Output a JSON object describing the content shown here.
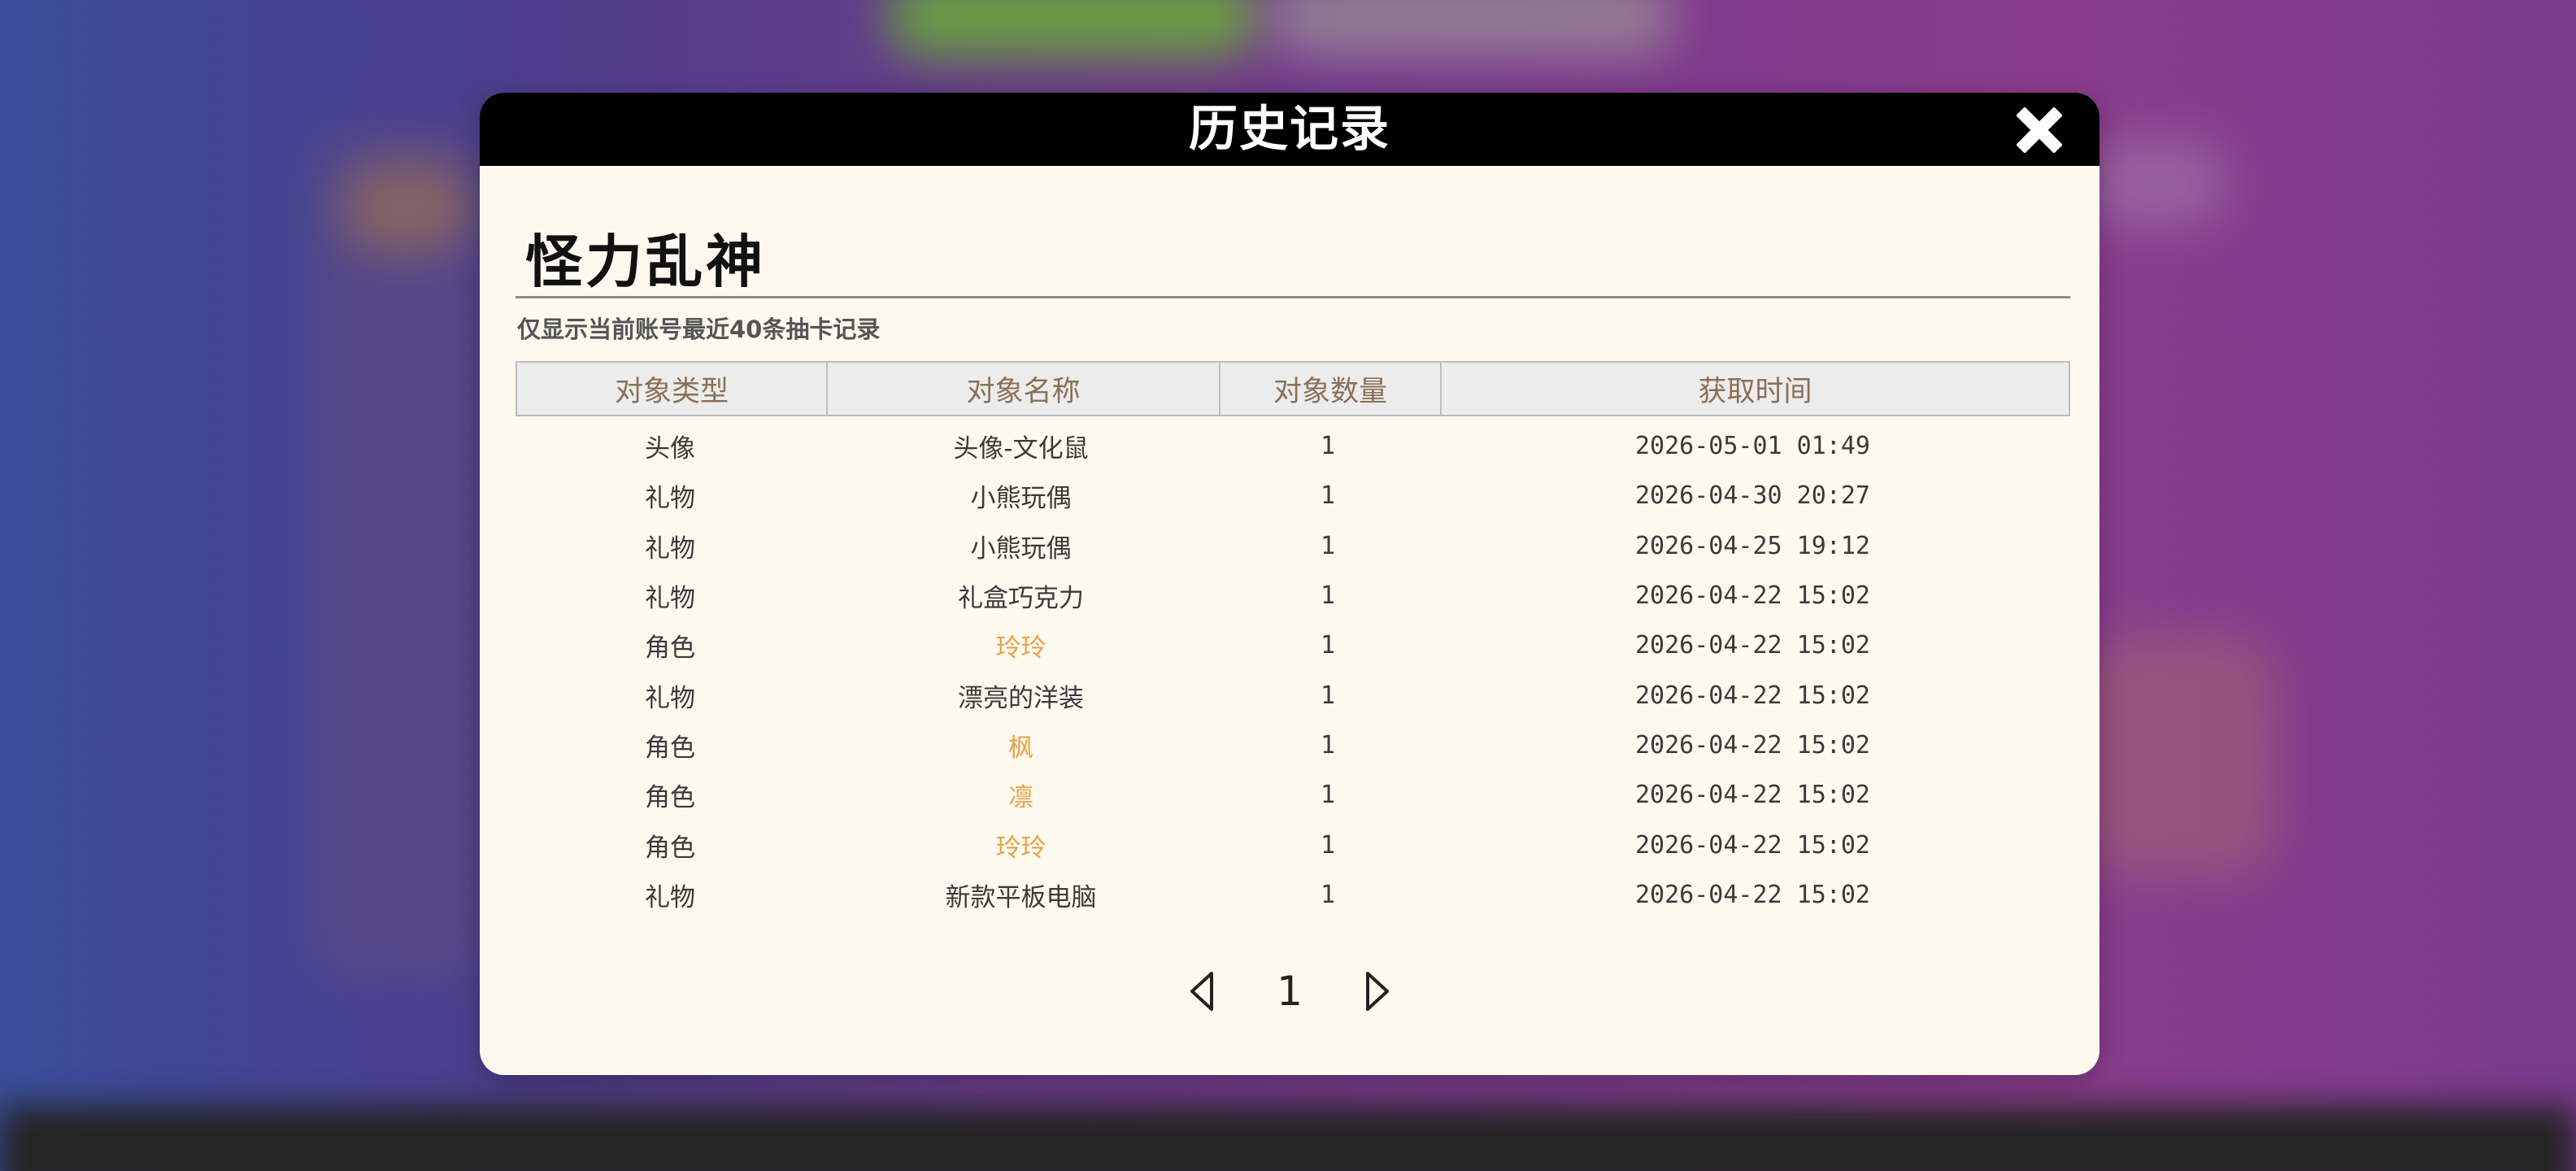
{
  "dialog": {
    "title": "历史记录",
    "section_title": "怪力乱神",
    "notice": "仅显示当前账号最近40条抽卡记录"
  },
  "table": {
    "headers": [
      "对象类型",
      "对象名称",
      "对象数量",
      "获取时间"
    ],
    "rows": [
      {
        "type": "头像",
        "name": "头像-文化鼠",
        "count": "1",
        "time": "2026-05-01 01:49",
        "highlight": false
      },
      {
        "type": "礼物",
        "name": "小熊玩偶",
        "count": "1",
        "time": "2026-04-30 20:27",
        "highlight": false
      },
      {
        "type": "礼物",
        "name": "小熊玩偶",
        "count": "1",
        "time": "2026-04-25 19:12",
        "highlight": false
      },
      {
        "type": "礼物",
        "name": "礼盒巧克力",
        "count": "1",
        "time": "2026-04-22 15:02",
        "highlight": false
      },
      {
        "type": "角色",
        "name": "玲玲",
        "count": "1",
        "time": "2026-04-22 15:02",
        "highlight": true
      },
      {
        "type": "礼物",
        "name": "漂亮的洋装",
        "count": "1",
        "time": "2026-04-22 15:02",
        "highlight": false
      },
      {
        "type": "角色",
        "name": "枫",
        "count": "1",
        "time": "2026-04-22 15:02",
        "highlight": true
      },
      {
        "type": "角色",
        "name": "凛",
        "count": "1",
        "time": "2026-04-22 15:02",
        "highlight": true
      },
      {
        "type": "角色",
        "name": "玲玲",
        "count": "1",
        "time": "2026-04-22 15:02",
        "highlight": true
      },
      {
        "type": "礼物",
        "name": "新款平板电脑",
        "count": "1",
        "time": "2026-04-22 15:02",
        "highlight": false
      }
    ]
  },
  "pagination": {
    "current_page": "1"
  },
  "icons": {
    "close": "close-icon",
    "prev": "triangle-left-icon",
    "next": "triangle-right-icon"
  },
  "colors": {
    "header_bg": "#000000",
    "panel_bg": "#fdf9ef",
    "header_text": "#8b6f55",
    "highlight_text": "#e8a24a"
  }
}
